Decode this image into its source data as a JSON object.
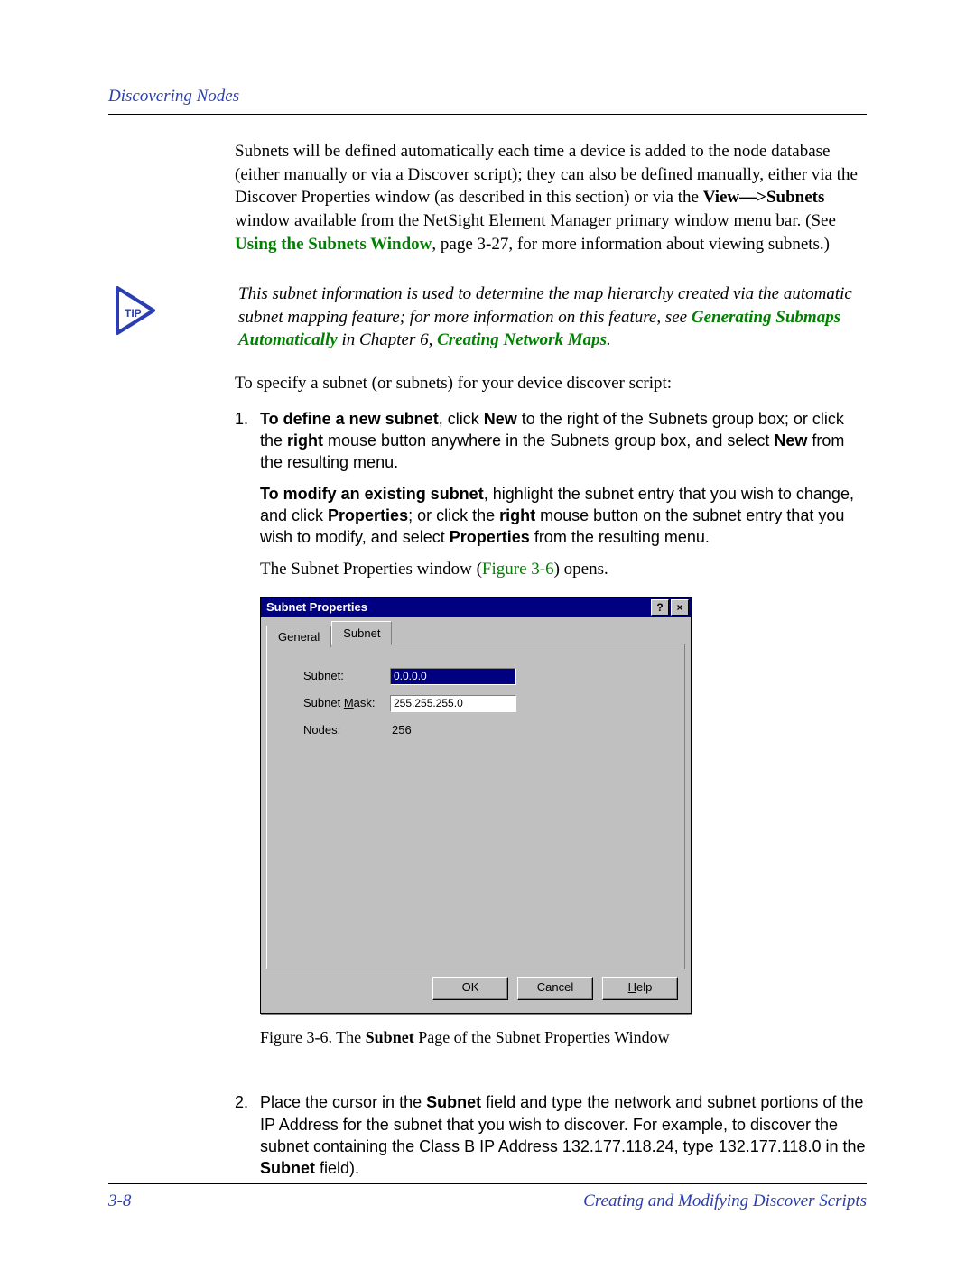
{
  "header": {
    "title": "Discovering Nodes"
  },
  "para1_a": "Subnets will be defined automatically each time a device is added to the node database (either manually or via a Discover script); they can also be defined manually, either via the Discover Properties window (as described in this section) or via the ",
  "para1_bold": "View—>Subnets",
  "para1_b": " window available from the NetSight Element Manager primary window menu bar. (See ",
  "para1_link": "Using the Subnets Window",
  "para1_c": ", page 3-27, for more information about viewing subnets.)",
  "tip": {
    "lead": "This subnet information is used to determine the map hierarchy created via the automatic subnet mapping feature; for more information on this feature, see ",
    "link1": "Generating Submaps Automatically",
    "mid": " in Chapter 6, ",
    "link2": "Creating Network Maps",
    "tail": "."
  },
  "para2": "To specify a subnet (or subnets) for your device discover script:",
  "steps": {
    "s1": {
      "num": "1.",
      "p1_a": "To define a new subnet",
      "p1_b": ", click ",
      "p1_c": "New",
      "p1_d": " to the right of the Subnets group box; or click the ",
      "p1_e": "right",
      "p1_f": " mouse button anywhere in the Subnets group box, and select ",
      "p1_g": "New",
      "p1_h": " from the resulting menu.",
      "p2_a": "To modify an existing subnet",
      "p2_b": ", highlight the subnet entry that you wish to change, and click ",
      "p2_c": "Properties",
      "p2_d": "; or click the ",
      "p2_e": "right",
      "p2_f": " mouse button on the subnet entry that you wish to modify, and select ",
      "p2_g": "Properties",
      "p2_h": " from the resulting menu.",
      "p3_a": "The Subnet Properties window (",
      "p3_link": "Figure 3-6",
      "p3_b": ") opens."
    },
    "s2": {
      "num": "2.",
      "a": "Place the cursor in the ",
      "b": "Subnet",
      "c": " field and type the network and subnet portions of the IP Address for the subnet that you wish to discover. For example, to discover the subnet containing the Class B IP Address 132.177.118.24, type 132.177.118.0 in the ",
      "d": "Subnet",
      "e": " field)."
    }
  },
  "dialog": {
    "title": "Subnet Properties",
    "help_glyph": "?",
    "close_glyph": "×",
    "tabs": {
      "general": "General",
      "subnet": "Subnet"
    },
    "labels": {
      "subnet_pre": "S",
      "subnet_ul": "u",
      "subnet_post": "bnet:",
      "mask_pre": "Subnet ",
      "mask_ul": "M",
      "mask_post": "ask:",
      "nodes": "Nodes:"
    },
    "values": {
      "subnet": "0.0.0.0",
      "mask": "255.255.255.0",
      "nodes": "256"
    },
    "buttons": {
      "ok": "OK",
      "cancel": "Cancel",
      "help_ul": "H",
      "help_post": "elp"
    }
  },
  "figure_caption_a": "Figure 3-6. The ",
  "figure_caption_b": "Subnet",
  "figure_caption_c": " Page of the Subnet Properties Window",
  "footer": {
    "left": "3-8",
    "right": "Creating and Modifying Discover Scripts"
  }
}
